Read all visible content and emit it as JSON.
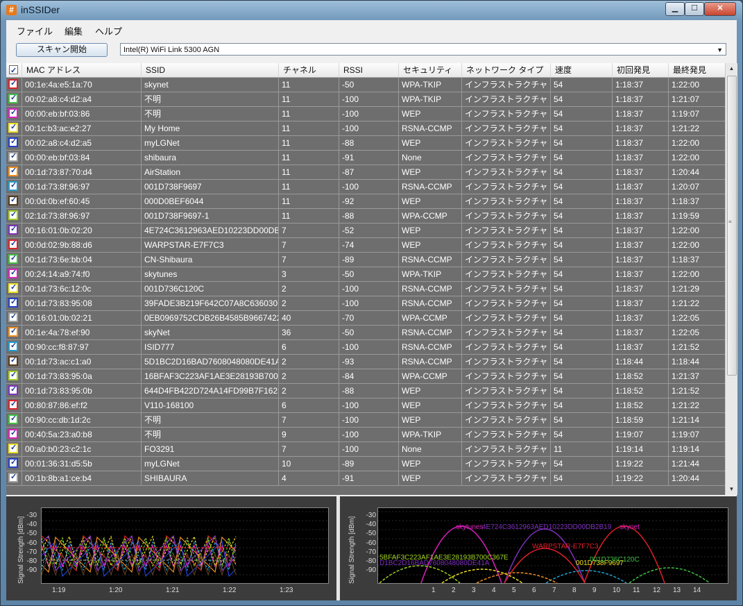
{
  "window": {
    "title": "inSSIDer",
    "icon": "#",
    "btn_min": "▁",
    "btn_max": "☐",
    "btn_close": "✕"
  },
  "menu": [
    "ファイル",
    "編集",
    "ヘルプ"
  ],
  "toolbar": {
    "scan_label": "スキャン開始",
    "adapter": "Intel(R) WiFi Link 5300 AGN",
    "arrow": "▼"
  },
  "columns": [
    "MAC アドレス",
    "SSID",
    "チャネル",
    "RSSI",
    "セキュリティ",
    "ネットワーク タイプ",
    "速度",
    "初回発見",
    "最終発見"
  ],
  "rows": [
    {
      "color": "#e0202a",
      "mac": "00:1e:4a:e5:1a:70",
      "ssid": "skynet",
      "ch": "11",
      "rssi": "-50",
      "sec": "WPA-TKIP",
      "type": "インフラストラクチャ",
      "speed": "54",
      "first": "1:18:37",
      "last": "1:22:00"
    },
    {
      "color": "#40c040",
      "mac": "00:02:a8:c4:d2:a4",
      "ssid": "不明",
      "ch": "11",
      "rssi": "-100",
      "sec": "WPA-TKIP",
      "type": "インフラストラクチャ",
      "speed": "54",
      "first": "1:18:37",
      "last": "1:21:07"
    },
    {
      "color": "#e020c0",
      "mac": "00:00:eb:bf:03:86",
      "ssid": "不明",
      "ch": "11",
      "rssi": "-100",
      "sec": "WEP",
      "type": "インフラストラクチャ",
      "speed": "54",
      "first": "1:18:37",
      "last": "1:19:07"
    },
    {
      "color": "#f0e020",
      "mac": "00:1c:b3:ac:e2:27",
      "ssid": "My Home",
      "ch": "11",
      "rssi": "-100",
      "sec": "RSNA-CCMP",
      "type": "インフラストラクチャ",
      "speed": "54",
      "first": "1:18:37",
      "last": "1:21:22"
    },
    {
      "color": "#2040d0",
      "mac": "00:02:a8:c4:d2:a5",
      "ssid": "myLGNet",
      "ch": "11",
      "rssi": "-88",
      "sec": "WEP",
      "type": "インフラストラクチャ",
      "speed": "54",
      "first": "1:18:37",
      "last": "1:22:00"
    },
    {
      "color": "#a0a0a0",
      "mac": "00:00:eb:bf:03:84",
      "ssid": "shibaura",
      "ch": "11",
      "rssi": "-91",
      "sec": "None",
      "type": "インフラストラクチャ",
      "speed": "54",
      "first": "1:18:37",
      "last": "1:22:00"
    },
    {
      "color": "#f09020",
      "mac": "00:1d:73:87:70:d4",
      "ssid": "AirStation",
      "ch": "11",
      "rssi": "-87",
      "sec": "WEP",
      "type": "インフラストラクチャ",
      "speed": "54",
      "first": "1:18:37",
      "last": "1:20:44"
    },
    {
      "color": "#20a0d0",
      "mac": "00:1d:73:8f:96:97",
      "ssid": "001D738F9697",
      "ch": "11",
      "rssi": "-100",
      "sec": "RSNA-CCMP",
      "type": "インフラストラクチャ",
      "speed": "54",
      "first": "1:18:37",
      "last": "1:20:07"
    },
    {
      "color": "#5a3a1a",
      "mac": "00:0d:0b:ef:60:45",
      "ssid": "000D0BEF6044",
      "ch": "11",
      "rssi": "-92",
      "sec": "WEP",
      "type": "インフラストラクチャ",
      "speed": "54",
      "first": "1:18:37",
      "last": "1:18:37"
    },
    {
      "color": "#a0d020",
      "mac": "02:1d:73:8f:96:97",
      "ssid": "001D738F9697-1",
      "ch": "11",
      "rssi": "-88",
      "sec": "WPA-CCMP",
      "type": "インフラストラクチャ",
      "speed": "54",
      "first": "1:18:37",
      "last": "1:19:59"
    },
    {
      "color": "#8030c0",
      "mac": "00:16:01:0b:02:20",
      "ssid": "4E724C3612963AED10223DD00DB...",
      "ch": "7",
      "rssi": "-52",
      "sec": "WEP",
      "type": "インフラストラクチャ",
      "speed": "54",
      "first": "1:18:37",
      "last": "1:22:00"
    },
    {
      "color": "#e0202a",
      "mac": "00:0d:02:9b:88:d6",
      "ssid": "WARPSTAR-E7F7C3",
      "ch": "7",
      "rssi": "-74",
      "sec": "WEP",
      "type": "インフラストラクチャ",
      "speed": "54",
      "first": "1:18:37",
      "last": "1:22:00"
    },
    {
      "color": "#40c040",
      "mac": "00:1d:73:6e:bb:04",
      "ssid": "CN-Shibaura",
      "ch": "7",
      "rssi": "-89",
      "sec": "RSNA-CCMP",
      "type": "インフラストラクチャ",
      "speed": "54",
      "first": "1:18:37",
      "last": "1:18:37"
    },
    {
      "color": "#e020c0",
      "mac": "00:24:14:a9:74:f0",
      "ssid": "skytunes",
      "ch": "3",
      "rssi": "-50",
      "sec": "WPA-TKIP",
      "type": "インフラストラクチャ",
      "speed": "54",
      "first": "1:18:37",
      "last": "1:22:00"
    },
    {
      "color": "#f0e020",
      "mac": "00:1d:73:6c:12:0c",
      "ssid": "001D736C120C",
      "ch": "2",
      "rssi": "-100",
      "sec": "RSNA-CCMP",
      "type": "インフラストラクチャ",
      "speed": "54",
      "first": "1:18:37",
      "last": "1:21:29"
    },
    {
      "color": "#2040d0",
      "mac": "00:1d:73:83:95:08",
      "ssid": "39FADE3B219F642C07A8C6360307...",
      "ch": "2",
      "rssi": "-100",
      "sec": "RSNA-CCMP",
      "type": "インフラストラクチャ",
      "speed": "54",
      "first": "1:18:37",
      "last": "1:21:22"
    },
    {
      "color": "#a0a0a0",
      "mac": "00:16:01:0b:02:21",
      "ssid": "0EB0969752CDB26B4585B9667422...",
      "ch": "40",
      "rssi": "-70",
      "sec": "WPA-CCMP",
      "type": "インフラストラクチャ",
      "speed": "54",
      "first": "1:18:37",
      "last": "1:22:05"
    },
    {
      "color": "#f09020",
      "mac": "00:1e:4a:78:ef:90",
      "ssid": "skyNet",
      "ch": "36",
      "rssi": "-50",
      "sec": "RSNA-CCMP",
      "type": "インフラストラクチャ",
      "speed": "54",
      "first": "1:18:37",
      "last": "1:22:05"
    },
    {
      "color": "#20a0d0",
      "mac": "00:90:cc:f8:87:97",
      "ssid": "ISID777",
      "ch": "6",
      "rssi": "-100",
      "sec": "RSNA-CCMP",
      "type": "インフラストラクチャ",
      "speed": "54",
      "first": "1:18:37",
      "last": "1:21:52"
    },
    {
      "color": "#5a3a1a",
      "mac": "00:1d:73:ac:c1:a0",
      "ssid": "5D1BC2D16BAD7608048080DE41A...",
      "ch": "2",
      "rssi": "-93",
      "sec": "RSNA-CCMP",
      "type": "インフラストラクチャ",
      "speed": "54",
      "first": "1:18:44",
      "last": "1:18:44"
    },
    {
      "color": "#a0d020",
      "mac": "00:1d:73:83:95:0a",
      "ssid": "16BFAF3C223AF1AE3E28193B700C...",
      "ch": "2",
      "rssi": "-84",
      "sec": "WPA-CCMP",
      "type": "インフラストラクチャ",
      "speed": "54",
      "first": "1:18:52",
      "last": "1:21:37"
    },
    {
      "color": "#8030c0",
      "mac": "00:1d:73:83:95:0b",
      "ssid": "644D4FB422D724A14FD99B7F1625...",
      "ch": "2",
      "rssi": "-88",
      "sec": "WEP",
      "type": "インフラストラクチャ",
      "speed": "54",
      "first": "1:18:52",
      "last": "1:21:52"
    },
    {
      "color": "#e0202a",
      "mac": "00:80:87:86:ef:f2",
      "ssid": "V110-168100",
      "ch": "6",
      "rssi": "-100",
      "sec": "WEP",
      "type": "インフラストラクチャ",
      "speed": "54",
      "first": "1:18:52",
      "last": "1:21:22"
    },
    {
      "color": "#40c040",
      "mac": "00:90:cc:db:1d:2c",
      "ssid": "不明",
      "ch": "7",
      "rssi": "-100",
      "sec": "WEP",
      "type": "インフラストラクチャ",
      "speed": "54",
      "first": "1:18:59",
      "last": "1:21:14"
    },
    {
      "color": "#e020c0",
      "mac": "00:40:5a:23:a0:b8",
      "ssid": "不明",
      "ch": "9",
      "rssi": "-100",
      "sec": "WPA-TKIP",
      "type": "インフラストラクチャ",
      "speed": "54",
      "first": "1:19:07",
      "last": "1:19:07"
    },
    {
      "color": "#f0e020",
      "mac": "00:a0:b0:23:c2:1c",
      "ssid": "FO3291",
      "ch": "7",
      "rssi": "-100",
      "sec": "None",
      "type": "インフラストラクチャ",
      "speed": "11",
      "first": "1:19:14",
      "last": "1:19:14"
    },
    {
      "color": "#2040d0",
      "mac": "00:01:36:31:d5:5b",
      "ssid": "myLGNet",
      "ch": "10",
      "rssi": "-89",
      "sec": "WEP",
      "type": "インフラストラクチャ",
      "speed": "54",
      "first": "1:19:22",
      "last": "1:21:44"
    },
    {
      "color": "#a0a0a0",
      "mac": "00:1b:8b:a1:ce:b4",
      "ssid": "SHIBAURA",
      "ch": "4",
      "rssi": "-91",
      "sec": "WEP",
      "type": "インフラストラクチャ",
      "speed": "54",
      "first": "1:19:22",
      "last": "1:20:44"
    }
  ],
  "graph_left": {
    "ylabel": "Signal Strength [dBm]",
    "yticks": [
      "-30",
      "-40",
      "-50",
      "-60",
      "-70",
      "-80",
      "-90"
    ],
    "xticks": [
      "1:19",
      "1:20",
      "1:21",
      "1:22",
      "1:23"
    ]
  },
  "graph_right": {
    "ylabel": "Signal Strength [dBm]",
    "yticks": [
      "-30",
      "-40",
      "-50",
      "-60",
      "-70",
      "-80",
      "-90"
    ],
    "xticks": [
      "1",
      "2",
      "3",
      "4",
      "5",
      "6",
      "7",
      "8",
      "9",
      "10",
      "11",
      "12",
      "13",
      "14"
    ],
    "labels": [
      "skytunes",
      "4E724C3612963AED10223DD00DB2B19",
      "skynet",
      "WARPSTAR-E7F7C3",
      "5BFAF3C223AF1AE3E28193B700C367E",
      "D1BC2D16BAD7608048080DE41A",
      "001D738F9697",
      "001D736C120C"
    ]
  }
}
